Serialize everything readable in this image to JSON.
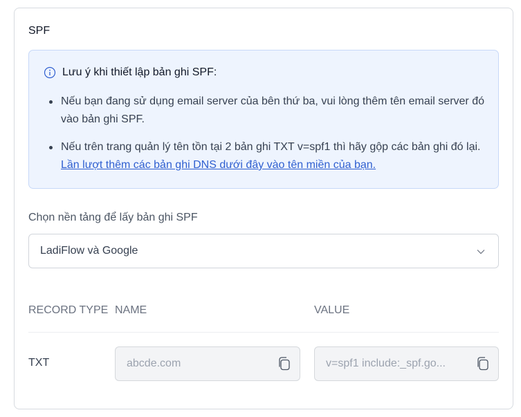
{
  "section_title": "SPF",
  "note": {
    "heading": "Lưu ý khi thiết lập bản ghi SPF:",
    "items": [
      {
        "text": "Nếu bạn đang sử dụng email server của bên thứ ba, vui lòng thêm tên email server đó vào bản ghi SPF."
      },
      {
        "text": "Nếu trên trang quản lý tên tồn tại 2 bản ghi TXT v=spf1 thì hãy gộp các bản ghi đó lại. ",
        "link": "Lần lượt thêm các bản ghi DNS dưới đây vào tên miền của bạn."
      }
    ],
    "icon": "info-circle-icon",
    "bg_color": "#eef4fe",
    "link_color": "#2f5fd0"
  },
  "platform": {
    "label": "Chọn nền tảng để lấy bản ghi SPF",
    "selected": "LadiFlow và Google"
  },
  "table": {
    "headers": {
      "record_type": "RECORD TYPE",
      "name": "NAME",
      "value": "VALUE"
    },
    "rows": [
      {
        "record_type": "TXT",
        "name": "abcde.com",
        "value": "v=spf1 include:_spf.go..."
      }
    ]
  }
}
